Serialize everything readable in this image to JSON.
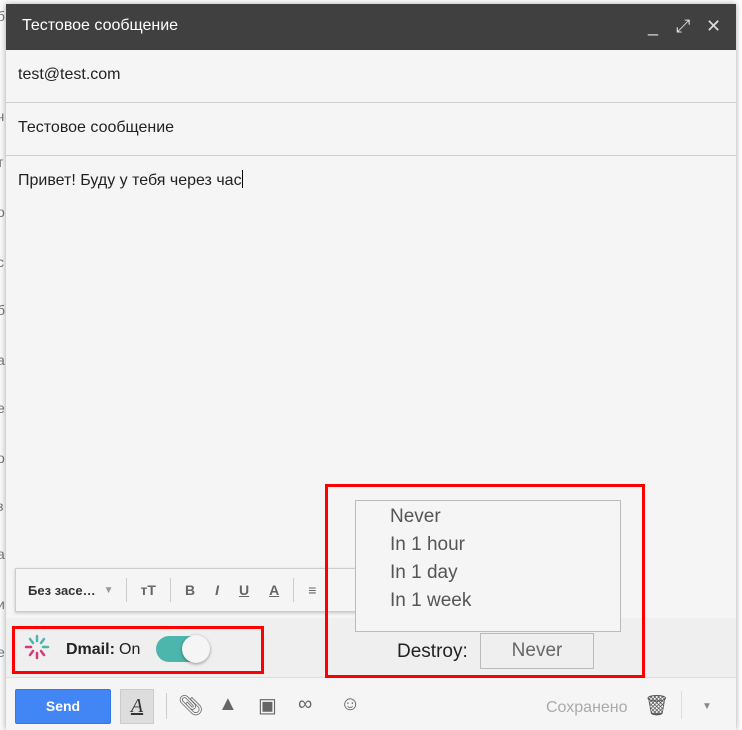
{
  "background_fragments": [
    "б",
    "ч",
    "т",
    "о",
    "с",
    "б",
    "а",
    "е",
    "о",
    "з",
    "а",
    "и",
    "е"
  ],
  "window": {
    "title": "Тестовое сообщение",
    "minimize": "_",
    "expand": "⤢",
    "close": "✕"
  },
  "to": "test@test.com",
  "subject": "Тестовое сообщение",
  "body": "Привет! Буду у тебя через час",
  "format": {
    "font": "Без засе…",
    "size": "тТ",
    "bold": "B",
    "italic": "I",
    "underline": "U",
    "color": "A"
  },
  "dmail": {
    "label": "Dmail:",
    "state": "On",
    "enabled": true,
    "destroy_label": "Destroy:",
    "destroy_value": "Never",
    "options": [
      "Never",
      "In 1 hour",
      "In 1 day",
      "In 1 week"
    ]
  },
  "bottom": {
    "send": "Send",
    "format_icon": "A",
    "saved": "Сохранено"
  },
  "colors": {
    "accent": "#4285f4",
    "toggle": "#4db6ac",
    "highlight": "#ff0000"
  }
}
